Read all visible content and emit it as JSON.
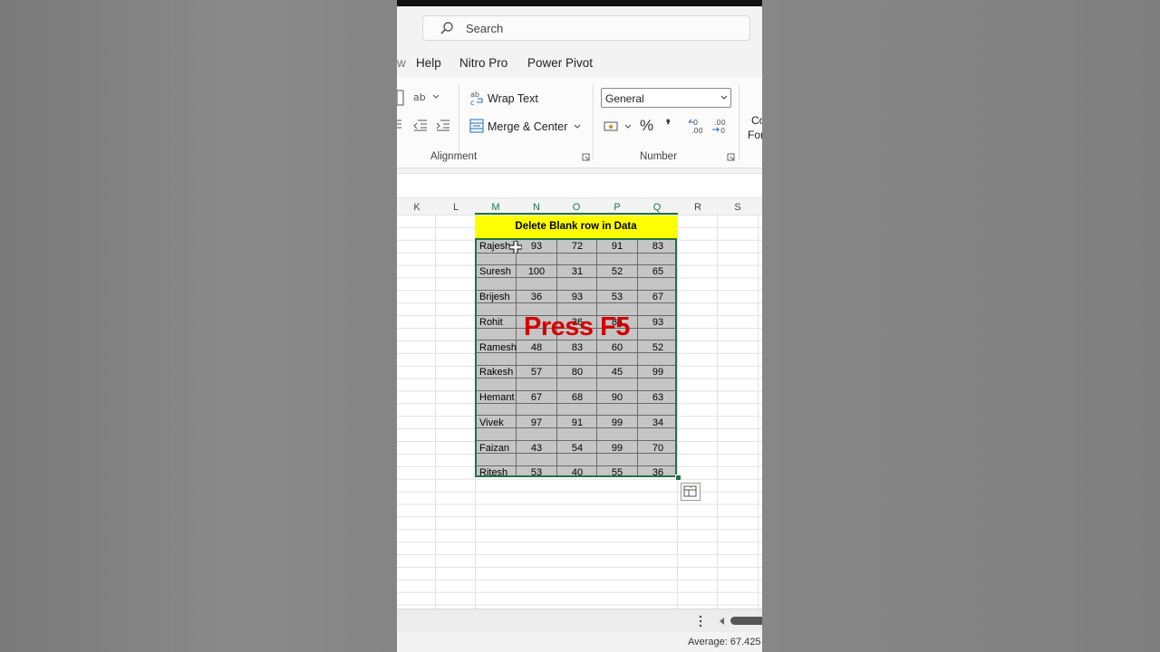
{
  "search": {
    "placeholder": "Search"
  },
  "tabs": [
    {
      "label": "Help"
    },
    {
      "label": "Nitro Pro"
    },
    {
      "label": "Power Pivot"
    }
  ],
  "ribbon": {
    "wrap_text": "Wrap Text",
    "merge_center": "Merge & Center",
    "number_format": "General",
    "alignment_label": "Alignment",
    "number_label": "Number",
    "percent": "%",
    "comma": "❜",
    "cut_label_top": "Co",
    "cut_label_bottom": "For"
  },
  "columns": [
    "K",
    "L",
    "M",
    "N",
    "O",
    "P",
    "Q",
    "R",
    "S"
  ],
  "sheet": {
    "title": "Delete Blank row in Data",
    "rows": [
      {
        "name": "Rajesh",
        "n": "93",
        "o": "72",
        "p": "91",
        "q": "83"
      },
      {
        "name": "Suresh",
        "n": "100",
        "o": "31",
        "p": "52",
        "q": "65"
      },
      {
        "name": "Brijesh",
        "n": "36",
        "o": "93",
        "p": "53",
        "q": "67"
      },
      {
        "name": "Rohit",
        "n": "",
        "o": "36",
        "p": "84",
        "q": "93"
      },
      {
        "name": "Ramesh",
        "n": "48",
        "o": "83",
        "p": "60",
        "q": "52"
      },
      {
        "name": "Rakesh",
        "n": "57",
        "o": "80",
        "p": "45",
        "q": "99"
      },
      {
        "name": "Hemant",
        "n": "67",
        "o": "68",
        "p": "90",
        "q": "63"
      },
      {
        "name": "Vivek",
        "n": "97",
        "o": "91",
        "p": "99",
        "q": "34"
      },
      {
        "name": "Faizan",
        "n": "43",
        "o": "54",
        "p": "99",
        "q": "70"
      },
      {
        "name": "Ritesh",
        "n": "53",
        "o": "40",
        "p": "55",
        "q": "36"
      }
    ]
  },
  "overlay_text": "Press F5",
  "status": {
    "average": "Average: 67.425"
  },
  "colors": {
    "accent": "#217346",
    "title_fill": "#ffff00",
    "overlay": "#d40000"
  }
}
